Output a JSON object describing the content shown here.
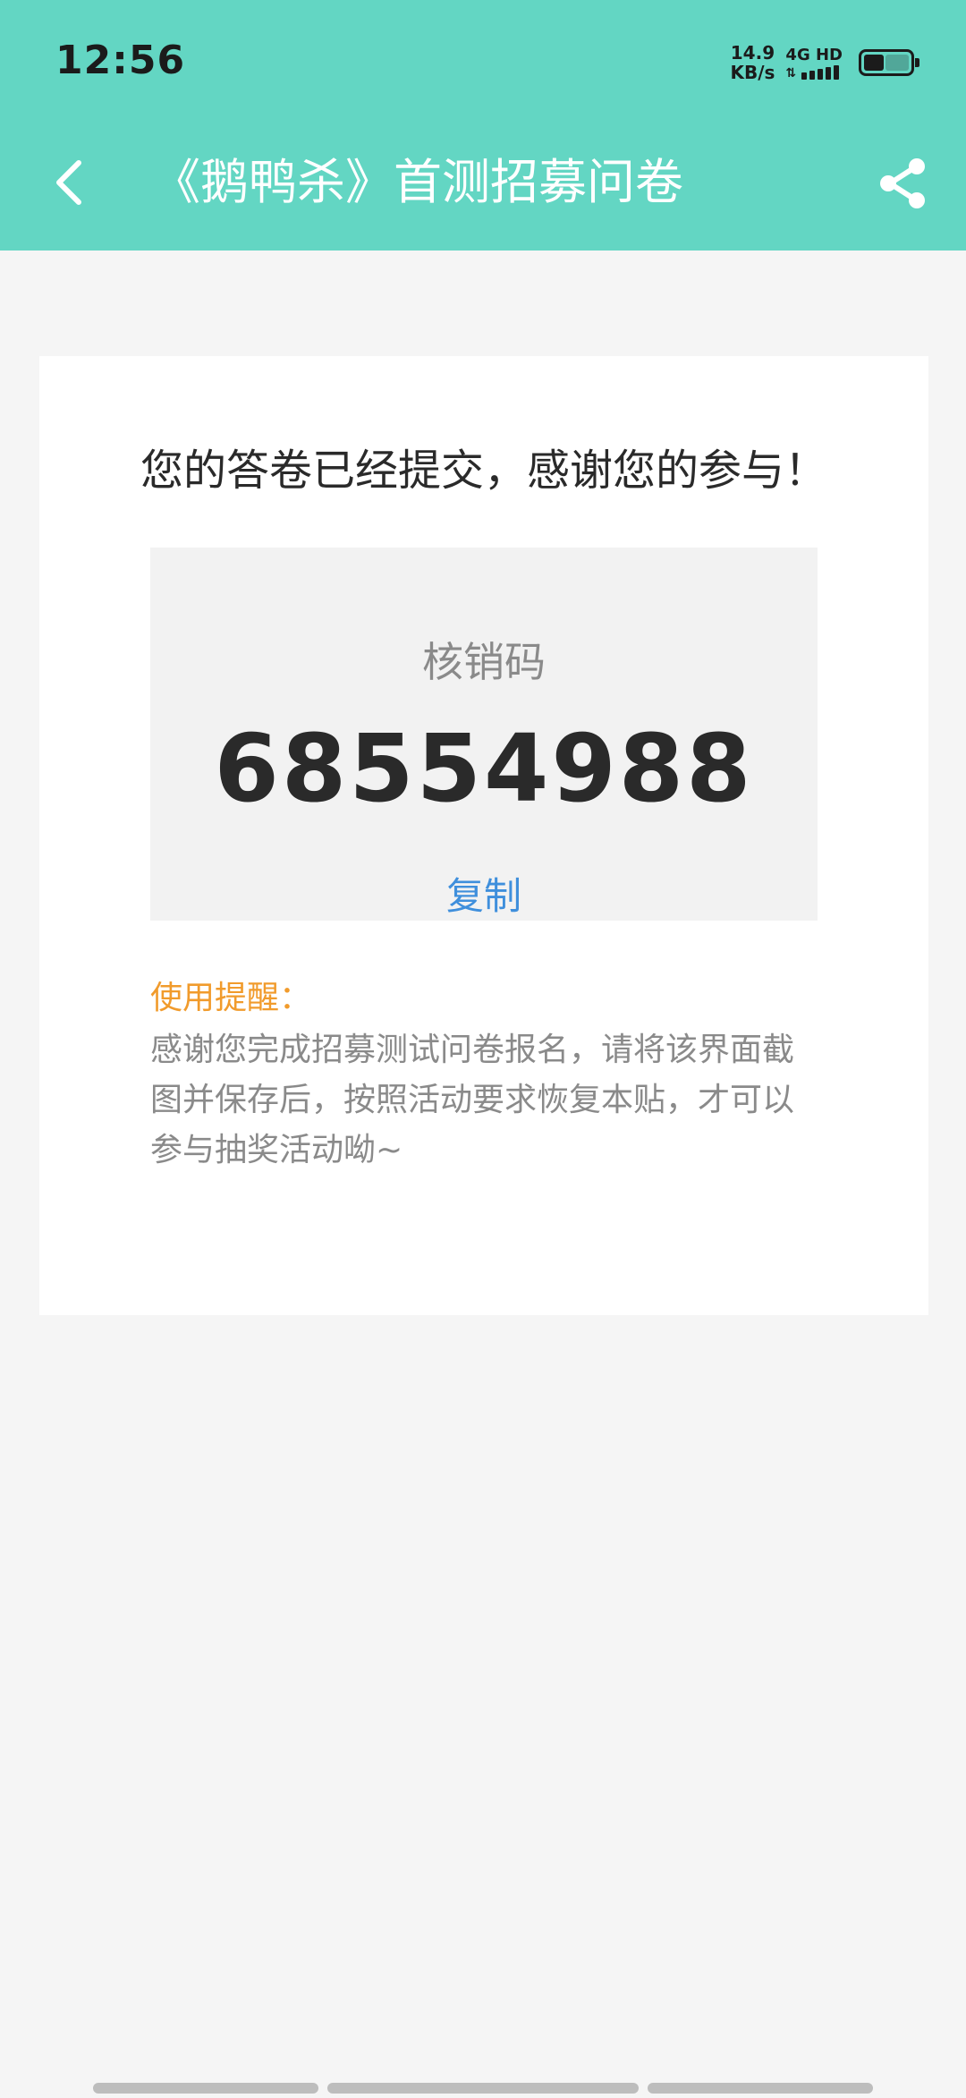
{
  "status_bar": {
    "time": "12:56",
    "net_speed_value": "14.9",
    "net_speed_unit": "KB/s",
    "network_type": "4G HD",
    "battery_icon": "battery-icon"
  },
  "header": {
    "title": "《鹅鸭杀》首测招募问卷",
    "back_icon": "back-arrow-icon",
    "share_icon": "share-icon",
    "background": "#63d6c3"
  },
  "card": {
    "heading": "您的答卷已经提交，感谢您的参与！",
    "code_label": "核销码",
    "code_value": "68554988",
    "copy_label": "复制",
    "tip_title": "使用提醒：",
    "tip_text": "感谢您完成招募测试问卷报名，请将该界面截图并保存后，按照活动要求恢复本贴，才可以参与抽奖活动呦~"
  },
  "colors": {
    "accent": "#63d6c3",
    "link": "#3f8fdc",
    "tip_title": "#f19b2c"
  }
}
